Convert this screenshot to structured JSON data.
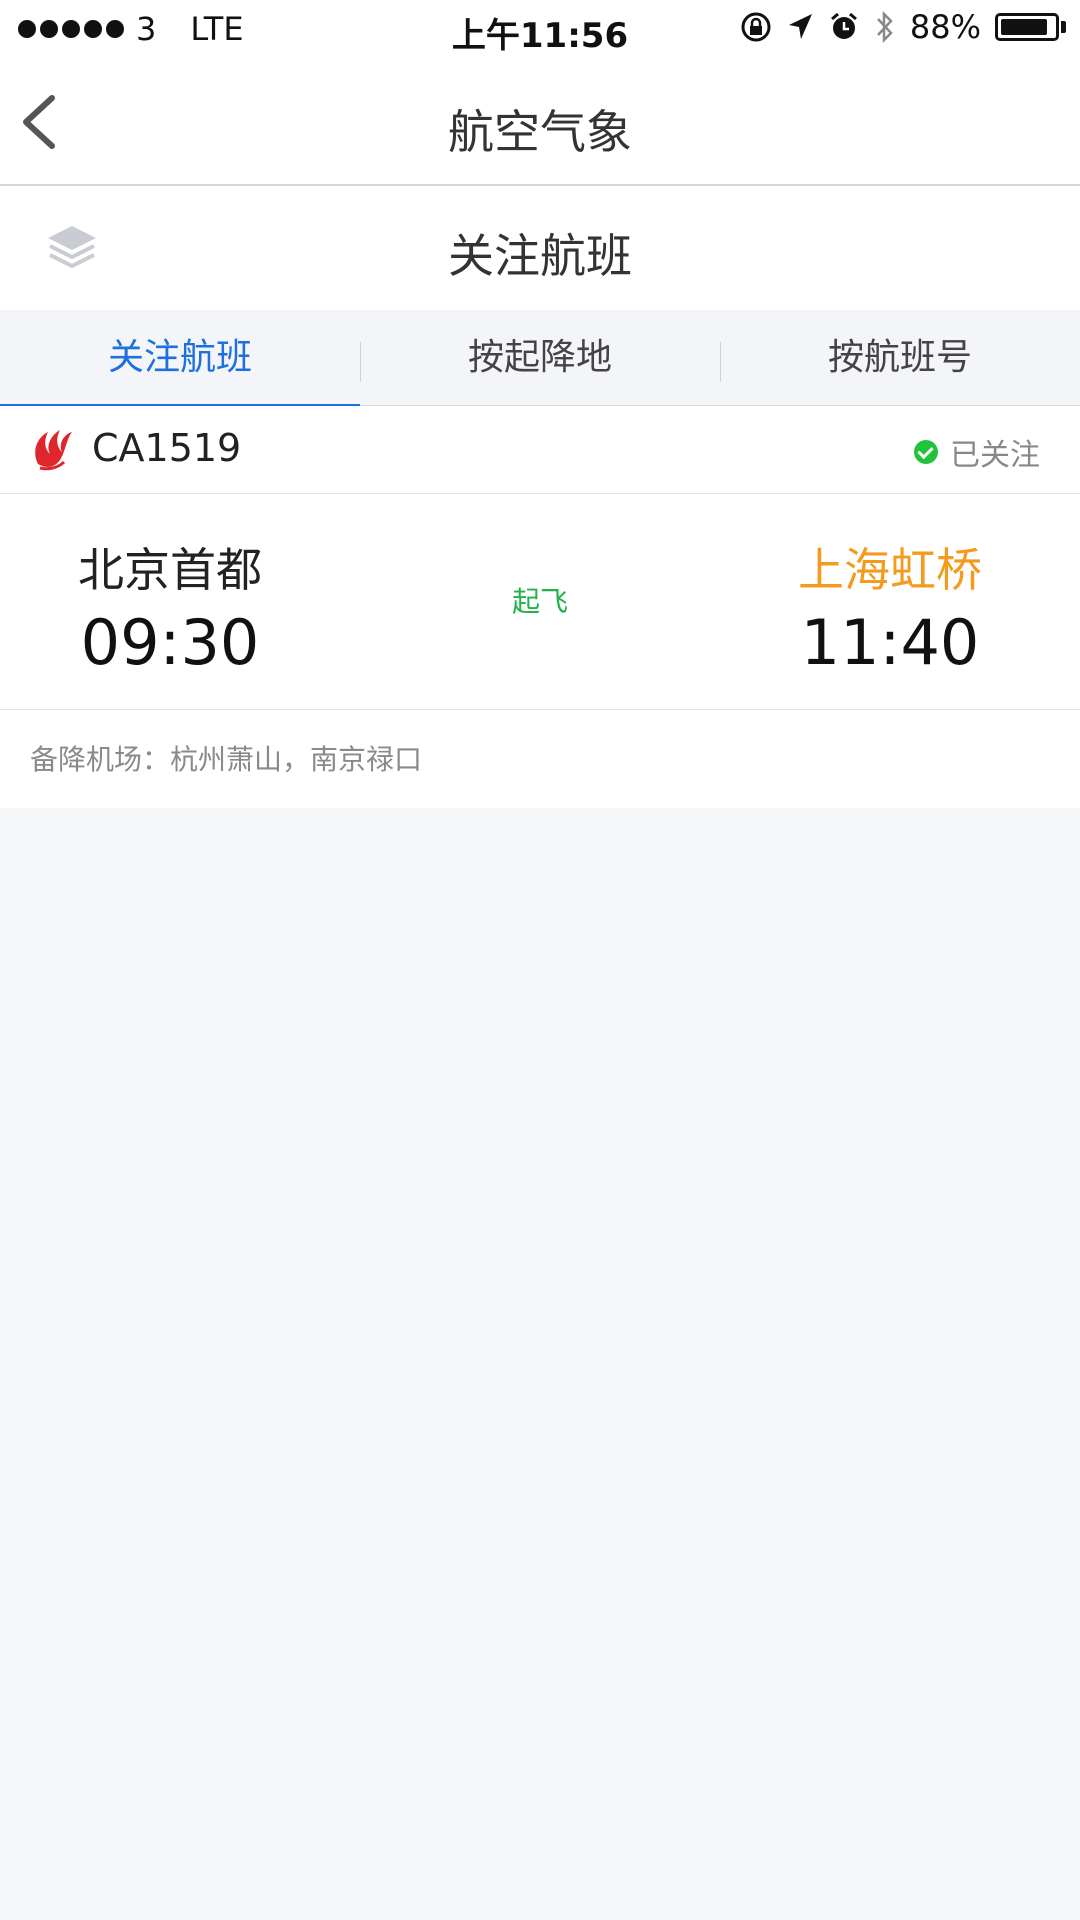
{
  "status_bar": {
    "carrier": "3",
    "network": "LTE",
    "time": "上午11:56",
    "battery": "88%",
    "battery_level": 0.88
  },
  "nav": {
    "title": "航空气象"
  },
  "section": {
    "title": "关注航班"
  },
  "tabs": [
    {
      "label": "关注航班",
      "active": true
    },
    {
      "label": "按起降地",
      "active": false
    },
    {
      "label": "按航班号",
      "active": false
    }
  ],
  "flight": {
    "number": "CA1519",
    "follow_label": "已关注",
    "departure": {
      "city": "北京首都",
      "time": "09:30"
    },
    "status": "起飞",
    "arrival": {
      "city": "上海虹桥",
      "time": "11:40"
    },
    "alternate": "备降机场：杭州萧山，南京禄口"
  },
  "colors": {
    "accent": "#1e6fe0",
    "status_green": "#22b24a",
    "arrival_orange": "#f39b1e",
    "airline_red": "#e0262d"
  }
}
